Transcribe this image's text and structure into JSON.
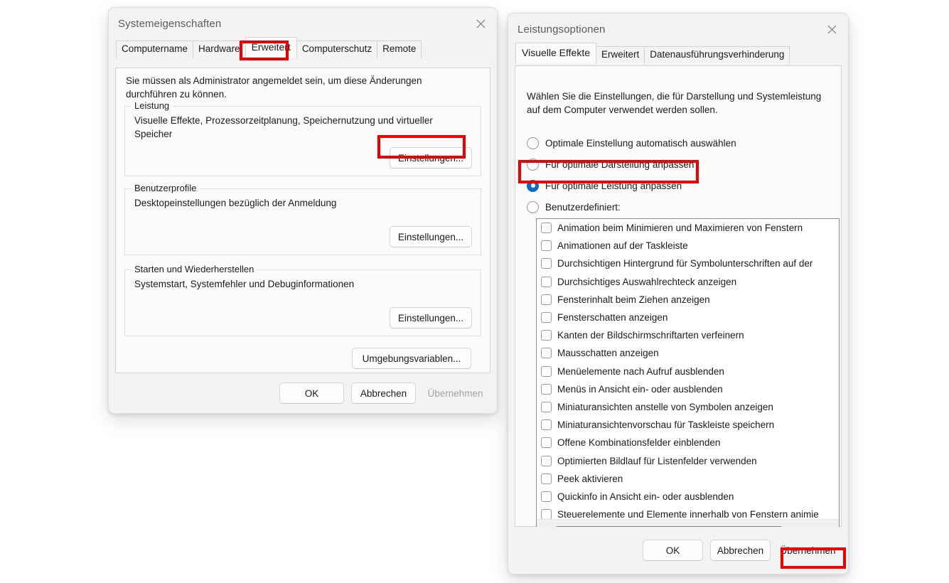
{
  "colors": {
    "accent": "#0a6cc4",
    "annotation_red": "#ee0000",
    "dialog_bg": "#f3f3f3",
    "page_bg": "#fbfbfb"
  },
  "system_properties_dialog": {
    "title": "Systemeigenschaften",
    "close_label": "✕",
    "tabs": [
      {
        "label": "Computername",
        "active": false
      },
      {
        "label": "Hardware",
        "active": false
      },
      {
        "label": "Erweitert",
        "active": true
      },
      {
        "label": "Computerschutz",
        "active": false
      },
      {
        "label": "Remote",
        "active": false
      }
    ],
    "intro": "Sie müssen als Administrator angemeldet sein, um diese Änderungen durchführen zu können.",
    "groups": [
      {
        "legend": "Leistung",
        "description": "Visuelle Effekte, Prozessorzeitplanung, Speichernutzung und virtueller Speicher",
        "button": "Einstellungen..."
      },
      {
        "legend": "Benutzerprofile",
        "description": "Desktopeinstellungen bezüglich der Anmeldung",
        "button": "Einstellungen..."
      },
      {
        "legend": "Starten und Wiederherstellen",
        "description": "Systemstart, Systemfehler und Debuginformationen",
        "button": "Einstellungen..."
      }
    ],
    "env_button": "Umgebungsvariablen...",
    "footer": {
      "ok": "OK",
      "cancel": "Abbrechen",
      "apply": "Übernehmen",
      "apply_disabled": true
    }
  },
  "performance_options_dialog": {
    "title": "Leistungsoptionen",
    "close_label": "✕",
    "tabs": [
      {
        "label": "Visuelle Effekte",
        "active": true
      },
      {
        "label": "Erweitert",
        "active": false
      },
      {
        "label": "Datenausführungsverhinderung",
        "active": false
      }
    ],
    "intro": "Wählen Sie die Einstellungen, die für Darstellung und Systemleistung auf dem Computer verwendet werden sollen.",
    "radios": [
      {
        "label": "Optimale Einstellung automatisch auswählen",
        "checked": false
      },
      {
        "label": "Für optimale Darstellung anpassen",
        "checked": false
      },
      {
        "label": "Für optimale Leistung anpassen",
        "checked": true
      },
      {
        "label": "Benutzerdefiniert:",
        "checked": false
      }
    ],
    "effects": [
      {
        "label": "Animation beim Minimieren und Maximieren von Fenstern",
        "checked": false
      },
      {
        "label": "Animationen auf der Taskleiste",
        "checked": false
      },
      {
        "label": "Durchsichtigen Hintergrund für Symbolunterschriften auf der",
        "checked": false
      },
      {
        "label": "Durchsichtiges Auswahlrechteck anzeigen",
        "checked": false
      },
      {
        "label": "Fensterinhalt beim Ziehen anzeigen",
        "checked": false
      },
      {
        "label": "Fensterschatten anzeigen",
        "checked": false
      },
      {
        "label": "Kanten der Bildschirmschriftarten verfeinern",
        "checked": false
      },
      {
        "label": "Mausschatten anzeigen",
        "checked": false
      },
      {
        "label": "Menüelemente nach Aufruf ausblenden",
        "checked": false
      },
      {
        "label": "Menüs in Ansicht ein- oder ausblenden",
        "checked": false
      },
      {
        "label": "Miniaturansichten anstelle von Symbolen anzeigen",
        "checked": false
      },
      {
        "label": "Miniaturansichtenvorschau für Taskleiste speichern",
        "checked": false
      },
      {
        "label": "Offene Kombinationsfelder einblenden",
        "checked": false
      },
      {
        "label": "Optimierten Bildlauf für Listenfelder verwenden",
        "checked": false
      },
      {
        "label": "Peek aktivieren",
        "checked": false
      },
      {
        "label": "Quickinfo in Ansicht ein- oder ausblenden",
        "checked": false
      },
      {
        "label": "Steuerelemente und Elemente innerhalb von Fenstern animie",
        "checked": false
      }
    ],
    "footer": {
      "ok": "OK",
      "cancel": "Abbrechen",
      "apply": "Übernehmen",
      "apply_disabled": false
    }
  },
  "annotations": [
    {
      "target": "tab-erweitert"
    },
    {
      "target": "leistung-einstellungen-button"
    },
    {
      "target": "radio-fuer-optimale-leistung-anpassen"
    },
    {
      "target": "performance-apply-button"
    }
  ]
}
